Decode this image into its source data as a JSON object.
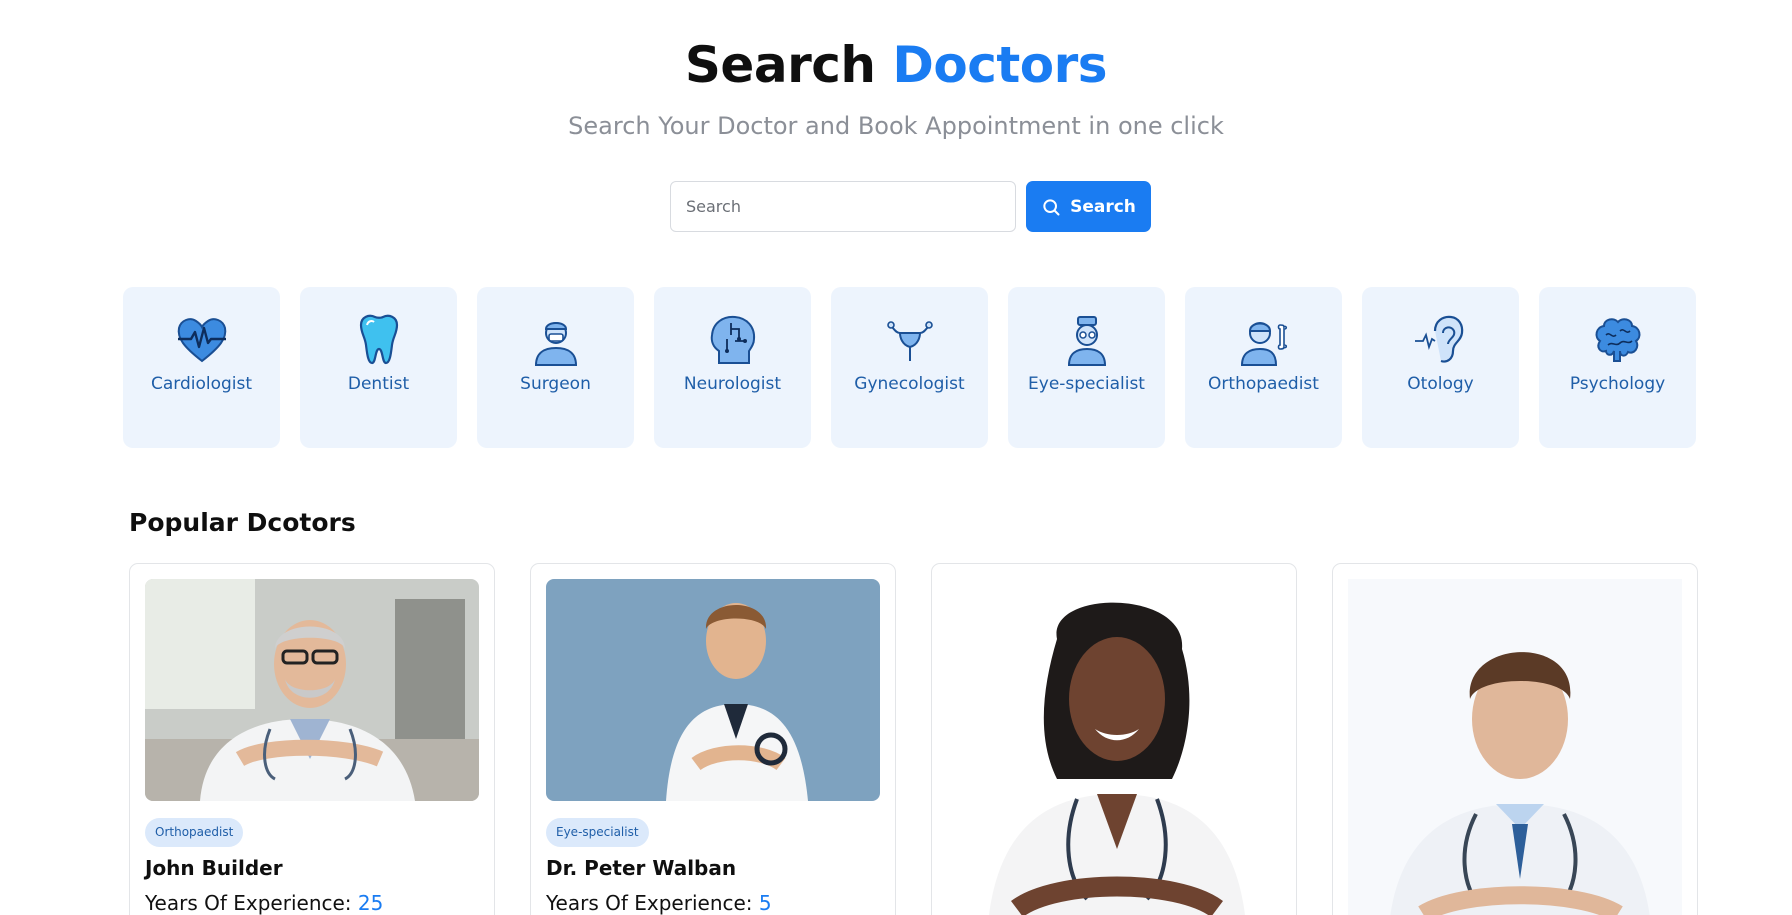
{
  "hero": {
    "title_part1": "Search",
    "title_part2": "Doctors",
    "subtitle": "Search Your Doctor and Book Appointment in one click"
  },
  "search": {
    "placeholder": "Search",
    "button_label": "Search"
  },
  "specialties": [
    {
      "label": "Cardiologist",
      "icon": "heart-pulse-icon"
    },
    {
      "label": "Dentist",
      "icon": "tooth-icon"
    },
    {
      "label": "Surgeon",
      "icon": "surgeon-icon"
    },
    {
      "label": "Neurologist",
      "icon": "brain-head-icon"
    },
    {
      "label": "Gynecologist",
      "icon": "uterus-icon"
    },
    {
      "label": "Eye-specialist",
      "icon": "eye-doctor-icon"
    },
    {
      "label": "Orthopaedist",
      "icon": "orthopaedist-icon"
    },
    {
      "label": "Otology",
      "icon": "ear-icon"
    },
    {
      "label": "Psychology",
      "icon": "brain-icon"
    }
  ],
  "popular": {
    "title": "Popular Dcotors",
    "doctors": [
      {
        "specialty": "Orthopaedist",
        "name": "John Builder",
        "experience_label": "Years Of Experience:",
        "experience_years": "25"
      },
      {
        "specialty": "Eye-specialist",
        "name": "Dr. Peter Walban",
        "experience_label": "Years Of Experience:",
        "experience_years": "5"
      },
      {
        "specialty": "",
        "name": "",
        "experience_label": "",
        "experience_years": ""
      },
      {
        "specialty": "",
        "name": "",
        "experience_label": "",
        "experience_years": ""
      }
    ]
  },
  "colors": {
    "accent": "#1a7cf2",
    "tile_bg": "#edf4fd",
    "tile_text": "#1f5ea8",
    "muted_text": "#8b8f97"
  }
}
